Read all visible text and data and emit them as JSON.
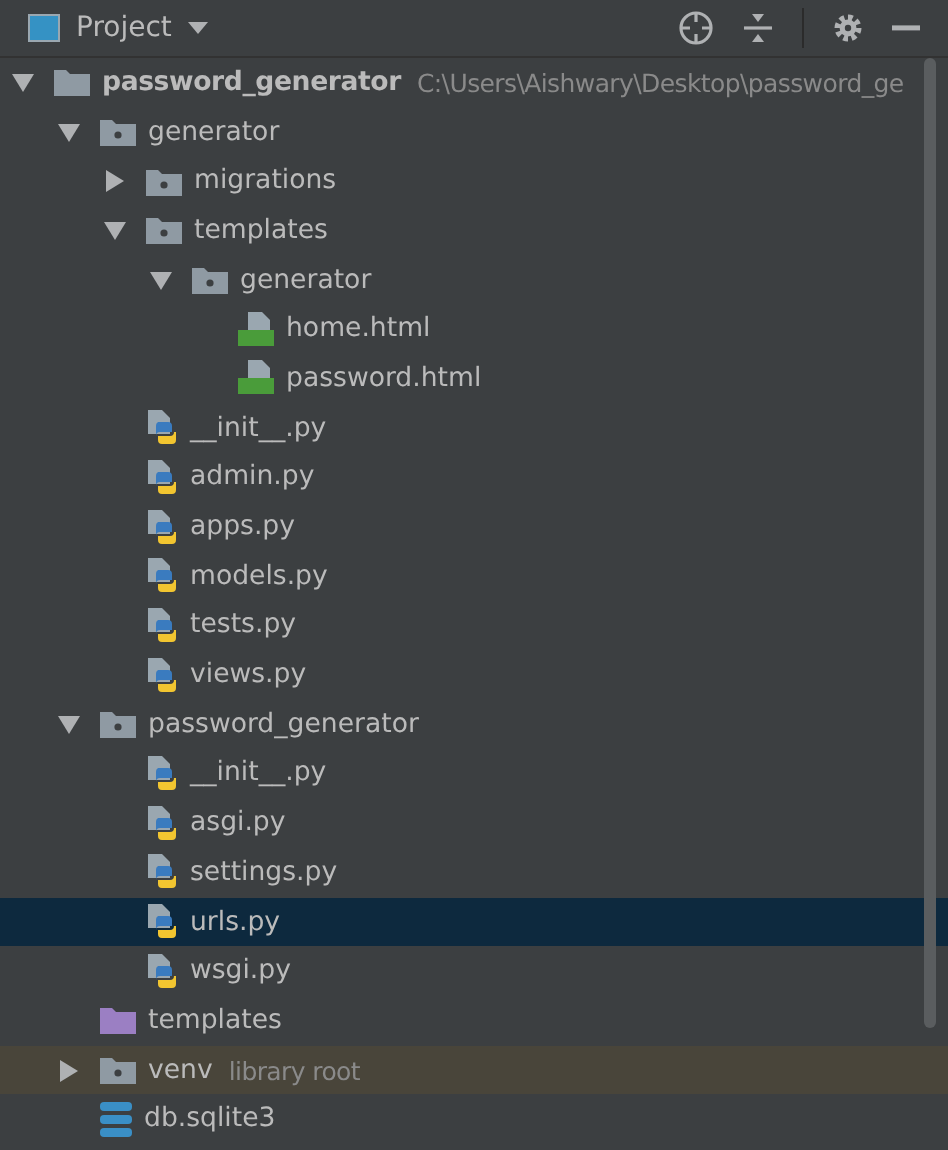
{
  "header": {
    "title": "Project"
  },
  "tree": [
    {
      "name": "password_generator",
      "kind": "folder",
      "path": "C:\\Users\\Aishwary\\Desktop\\password_ge",
      "expanded": true,
      "selected": false,
      "children": [
        {
          "name": "generator",
          "kind": "package",
          "expanded": true,
          "selected": false,
          "children": [
            {
              "name": "migrations",
              "kind": "package",
              "expanded": false,
              "selected": false
            },
            {
              "name": "templates",
              "kind": "package",
              "expanded": true,
              "selected": false,
              "children": [
                {
                  "name": "generator",
                  "kind": "package",
                  "expanded": true,
                  "selected": false,
                  "children": [
                    {
                      "name": "home.html",
                      "kind": "html",
                      "selected": false
                    },
                    {
                      "name": "password.html",
                      "kind": "html",
                      "selected": false
                    }
                  ]
                }
              ]
            },
            {
              "name": "__init__.py",
              "kind": "python",
              "selected": false
            },
            {
              "name": "admin.py",
              "kind": "python",
              "selected": false
            },
            {
              "name": "apps.py",
              "kind": "python",
              "selected": false
            },
            {
              "name": "models.py",
              "kind": "python",
              "selected": false
            },
            {
              "name": "tests.py",
              "kind": "python",
              "selected": false
            },
            {
              "name": "views.py",
              "kind": "python",
              "selected": false
            }
          ]
        },
        {
          "name": "password_generator",
          "kind": "package",
          "expanded": true,
          "selected": false,
          "children": [
            {
              "name": "__init__.py",
              "kind": "python",
              "selected": false
            },
            {
              "name": "asgi.py",
              "kind": "python",
              "selected": false
            },
            {
              "name": "settings.py",
              "kind": "python",
              "selected": false
            },
            {
              "name": "urls.py",
              "kind": "python",
              "selected": true
            },
            {
              "name": "wsgi.py",
              "kind": "python",
              "selected": false
            }
          ]
        },
        {
          "name": "templates",
          "kind": "resource",
          "selected": false
        },
        {
          "name": "venv",
          "kind": "library",
          "note": "library root",
          "expanded": false,
          "selected": false
        },
        {
          "name": "db.sqlite3",
          "kind": "database",
          "selected": false
        }
      ]
    }
  ]
}
